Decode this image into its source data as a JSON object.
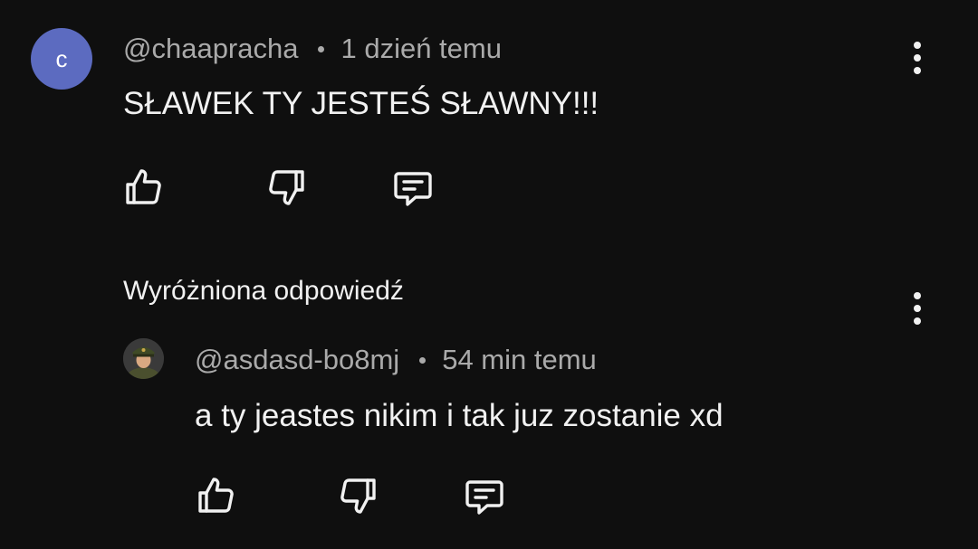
{
  "comment": {
    "avatar_letter": "c",
    "author": "@chaapracha",
    "time": "1 dzień temu",
    "text": "SŁAWEK TY JESTEŚ SŁAWNY!!!"
  },
  "highlighted_label": "Wyróżniona odpowiedź",
  "reply": {
    "author": "@asdasd-bo8mj",
    "time": "54 min temu",
    "text": "a ty jeastes nikim i tak juz zostanie xd"
  },
  "icons": {
    "like": "thumbs-up-icon",
    "dislike": "thumbs-down-icon",
    "reply": "comment-icon",
    "more": "more-vertical-icon"
  },
  "colors": {
    "background": "#0f0f0f",
    "text": "#f1f1f1",
    "meta": "#aaaaaa",
    "avatar": "#5c6bc0"
  }
}
